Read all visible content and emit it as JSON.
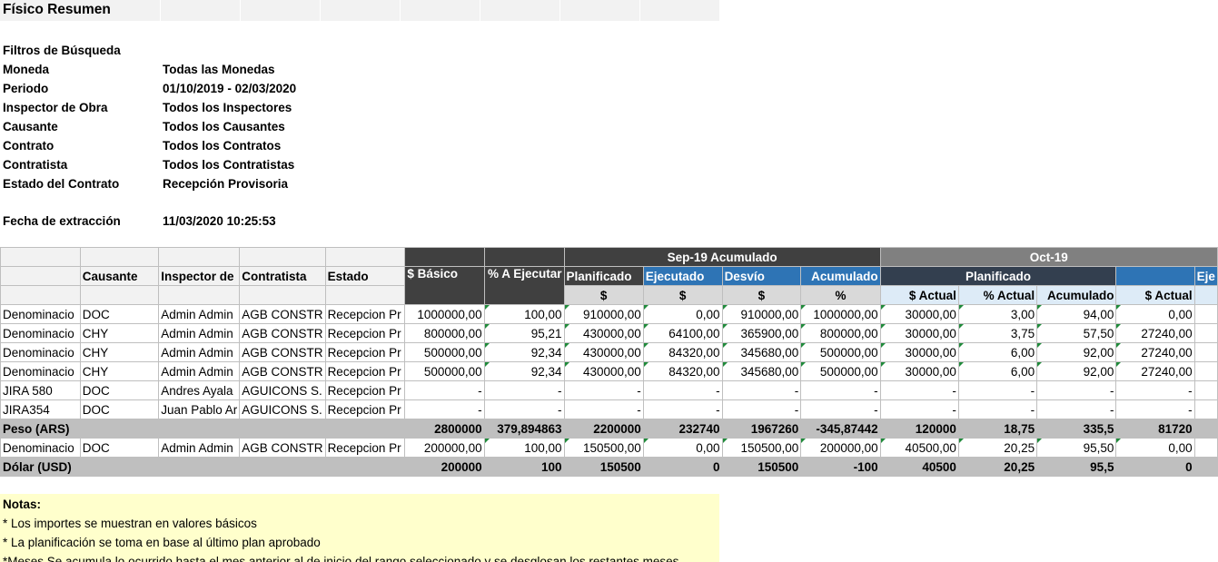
{
  "sheet": {
    "title": "Físico Resumen"
  },
  "filters": {
    "heading": "Filtros de Búsqueda",
    "items": [
      {
        "label": "Moneda",
        "value": "Todas las Monedas"
      },
      {
        "label": "Periodo",
        "value": "01/10/2019 - 02/03/2020"
      },
      {
        "label": "Inspector de Obra",
        "value": "Todos los Inspectores"
      },
      {
        "label": "Causante",
        "value": "Todos los Causantes"
      },
      {
        "label": "Contrato",
        "value": "Todos los Contratos"
      },
      {
        "label": "Contratista",
        "value": "Todos los Contratistas"
      },
      {
        "label": "Estado del Contrato",
        "value": "Recepción Provisoria"
      }
    ],
    "extraction_label": "Fecha de extracción",
    "extraction_value": "11/03/2020 10:25:53"
  },
  "table": {
    "group_sep": "Sep-19 Acumulado",
    "group_oct": "Oct-19",
    "headers": {
      "causante": "Causante",
      "inspector": "Inspector de",
      "contratista": "Contratista",
      "estado": "Estado",
      "basico": "$ Básico",
      "a_ejecutar": "% A Ejecutar",
      "planificado": "Planificado",
      "ejecutado": "Ejecutado",
      "desvio": "Desvío",
      "acumulado": "Acumulado",
      "oct_planificado": "Planificado",
      "oct_ejecutado": "Eje"
    },
    "subheaders": {
      "s1": "$",
      "s2": "$",
      "s3": "$",
      "s4": "%",
      "o1": "$ Actual",
      "o2": "% Actual",
      "o3": "Acumulado",
      "o4": "$ Actual"
    },
    "rows": [
      {
        "name": "Denominacio",
        "causante": "DOC",
        "inspector": "Admin Admin",
        "contratista": "AGB CONSTR",
        "estado": "Recepcion Pr",
        "v": [
          "1000000,00",
          "100,00",
          "910000,00",
          "0,00",
          "910000,00",
          "1000000,00",
          "30000,00",
          "3,00",
          "94,00",
          "0,00"
        ],
        "total": false
      },
      {
        "name": "Denominacio",
        "causante": "CHY",
        "inspector": "Admin Admin",
        "contratista": "AGB CONSTR",
        "estado": "Recepcion Pr",
        "v": [
          "800000,00",
          "95,21",
          "430000,00",
          "64100,00",
          "365900,00",
          "800000,00",
          "30000,00",
          "3,75",
          "57,50",
          "27240,00"
        ],
        "total": false
      },
      {
        "name": "Denominacio",
        "causante": "CHY",
        "inspector": "Admin Admin",
        "contratista": "AGB CONSTR",
        "estado": "Recepcion Pr",
        "v": [
          "500000,00",
          "92,34",
          "430000,00",
          "84320,00",
          "345680,00",
          "500000,00",
          "30000,00",
          "6,00",
          "92,00",
          "27240,00"
        ],
        "total": false
      },
      {
        "name": "Denominacio",
        "causante": "CHY",
        "inspector": "Admin Admin",
        "contratista": "AGB CONSTR",
        "estado": "Recepcion Pr",
        "v": [
          "500000,00",
          "92,34",
          "430000,00",
          "84320,00",
          "345680,00",
          "500000,00",
          "30000,00",
          "6,00",
          "92,00",
          "27240,00"
        ],
        "total": false
      },
      {
        "name": "JIRA 580",
        "causante": "DOC",
        "inspector": "Andres Ayala",
        "contratista": "AGUICONS S.",
        "estado": "Recepcion Pr",
        "v": [
          "-",
          "-",
          "-",
          "-",
          "-",
          "-",
          "-",
          "-",
          "-",
          "-"
        ],
        "total": false
      },
      {
        "name": "JIRA354",
        "causante": "DOC",
        "inspector": "Juan Pablo Ar",
        "contratista": "AGUICONS S.",
        "estado": "Recepcion Pr",
        "v": [
          "-",
          "-",
          "-",
          "-",
          "-",
          "-",
          "-",
          "-",
          "-",
          "-"
        ],
        "total": false
      },
      {
        "name": "Peso (ARS)",
        "causante": "",
        "inspector": "",
        "contratista": "",
        "estado": "",
        "v": [
          "2800000",
          "379,894863",
          "2200000",
          "232740",
          "1967260",
          "-345,87442",
          "120000",
          "18,75",
          "335,5",
          "81720"
        ],
        "total": true
      },
      {
        "name": "Denominacio",
        "causante": "DOC",
        "inspector": "Admin Admin",
        "contratista": "AGB CONSTR",
        "estado": "Recepcion Pr",
        "v": [
          "200000,00",
          "100,00",
          "150500,00",
          "0,00",
          "150500,00",
          "200000,00",
          "40500,00",
          "20,25",
          "95,50",
          "0,00"
        ],
        "total": false
      },
      {
        "name": "Dólar (USD)",
        "causante": "",
        "inspector": "",
        "contratista": "",
        "estado": "",
        "v": [
          "200000",
          "100",
          "150500",
          "0",
          "150500",
          "-100",
          "40500",
          "20,25",
          "95,5",
          "0"
        ],
        "total": true
      }
    ]
  },
  "notes": {
    "heading": "Notas:",
    "lines": [
      "* Los importes se muestran en valores básicos",
      "* La planificación se toma en base al último plan aprobado",
      "*Meses Se acumula lo ocurrido hasta el mes anterior al de inicio del rango seleccionado y se desglosan los restantes meses"
    ]
  }
}
